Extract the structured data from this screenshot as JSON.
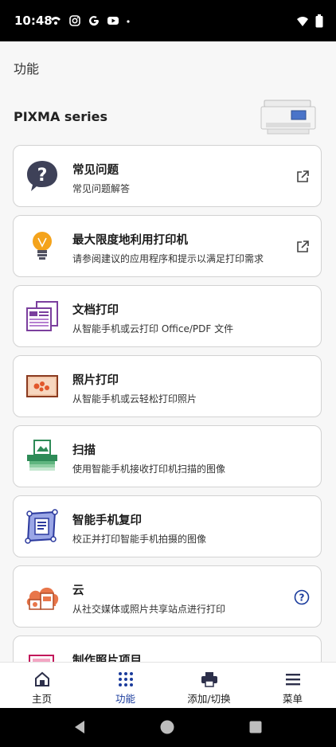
{
  "status_bar": {
    "time": "10:48",
    "icons": [
      "wifi-calling-icon",
      "instagram-icon",
      "google-icon",
      "youtube-icon",
      "dot-icon"
    ],
    "right_icons": [
      "wifi-icon",
      "battery-icon"
    ]
  },
  "header": {
    "title": "功能"
  },
  "series": {
    "name": "PIXMA series"
  },
  "cards": [
    {
      "title": "常见问题",
      "desc": "常见问题解答",
      "icon": "question-bubble-icon",
      "trail": "external-link-icon"
    },
    {
      "title": "最大限度地利用打印机",
      "desc": "请参阅建议的应用程序和提示以满足打印需求",
      "icon": "lightbulb-icon",
      "trail": "external-link-icon"
    },
    {
      "title": "文档打印",
      "desc": "从智能手机或云打印 Office/PDF 文件",
      "icon": "document-print-icon"
    },
    {
      "title": "照片打印",
      "desc": "从智能手机或云轻松打印照片",
      "icon": "photo-print-icon"
    },
    {
      "title": "扫描",
      "desc": "使用智能手机接收打印机扫描的图像",
      "icon": "scan-icon"
    },
    {
      "title": "智能手机复印",
      "desc": "校正并打印智能手机拍摄的图像",
      "icon": "smartphone-copy-icon"
    },
    {
      "title": "云",
      "desc": "从社交媒体或照片共享站点进行打印",
      "icon": "cloud-print-icon",
      "trail": "help-circle-icon"
    },
    {
      "title": "制作照片项目",
      "desc": "",
      "icon": "photo-project-icon"
    }
  ],
  "bottom_nav": [
    {
      "label": "主页",
      "icon": "home-icon",
      "active": false
    },
    {
      "label": "功能",
      "icon": "grid-dots-icon",
      "active": true
    },
    {
      "label": "添加/切换",
      "icon": "printer-icon",
      "active": false
    },
    {
      "label": "菜单",
      "icon": "hamburger-menu-icon",
      "active": false
    }
  ],
  "colors": {
    "accent": "#1a3b9c",
    "card_border": "#d2d2d2",
    "background": "#f7f7f7"
  }
}
